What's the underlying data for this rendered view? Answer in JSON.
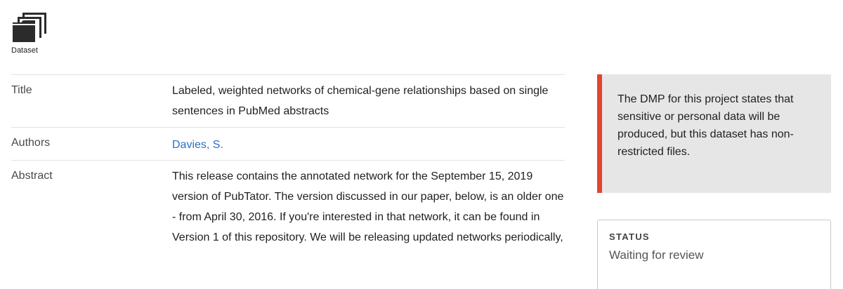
{
  "header": {
    "icon": "folder-stack-icon",
    "caption": "Dataset"
  },
  "metadata": {
    "title": {
      "label": "Title",
      "value": "Labeled, weighted networks of chemical-gene relationships based on single sentences in PubMed abstracts"
    },
    "authors": {
      "label": "Authors",
      "value": "Davies, S."
    },
    "abstract": {
      "label": "Abstract",
      "value": "This release contains the annotated network for the September 15, 2019 version of PubTator. The version discussed in our paper, below, is an older one - from April 30, 2016. If you're interested in that network, it can be found in Version 1 of this repository. We will be releasing updated networks periodically,"
    }
  },
  "notice": {
    "text": "The DMP for this project states that sensitive or personal data will be produced, but this dataset has non-restricted files.",
    "accent_color": "#e0452e"
  },
  "status": {
    "label": "STATUS",
    "value": "Waiting for review"
  },
  "colors": {
    "link": "#2a70c4",
    "notice_background": "#e6e6e6"
  }
}
